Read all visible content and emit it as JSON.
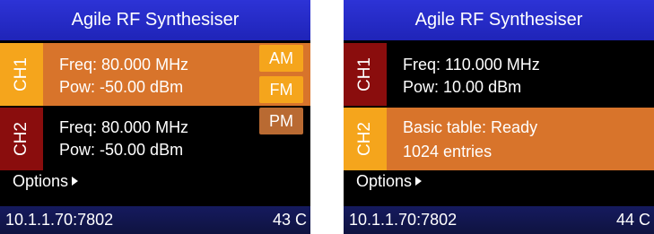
{
  "left": {
    "title": "Agile RF Synthesiser",
    "ch1": {
      "label": "CH1",
      "freq": "Freq: 80.000 MHz",
      "pow": "Pow: -50.00 dBm"
    },
    "ch2": {
      "label": "CH2",
      "freq": "Freq: 80.000 MHz",
      "pow": "Pow: -50.00 dBm"
    },
    "modulation": {
      "am": "AM",
      "fm": "FM",
      "pm": "PM"
    },
    "options": "Options",
    "status": {
      "ip": "10.1.1.70:7802",
      "temp": "43 C"
    }
  },
  "right": {
    "title": "Agile RF Synthesiser",
    "ch1": {
      "label": "CH1",
      "freq": "Freq: 110.000 MHz",
      "pow": "Pow: 10.00 dBm"
    },
    "ch2": {
      "label": "CH2",
      "line1": "Basic table: Ready",
      "line2": "1024 entries"
    },
    "options": "Options",
    "status": {
      "ip": "10.1.1.70:7802",
      "temp": "44 C"
    }
  },
  "colors": {
    "title_bar": "#2d33d6",
    "status_bar": "#151a5e",
    "active_row": "#d8742b",
    "active_tab": "#f5a51c",
    "inactive_tab": "#8a0d0d",
    "background": "#000000"
  },
  "icons": {
    "options_arrow": "triangle-right-icon"
  }
}
